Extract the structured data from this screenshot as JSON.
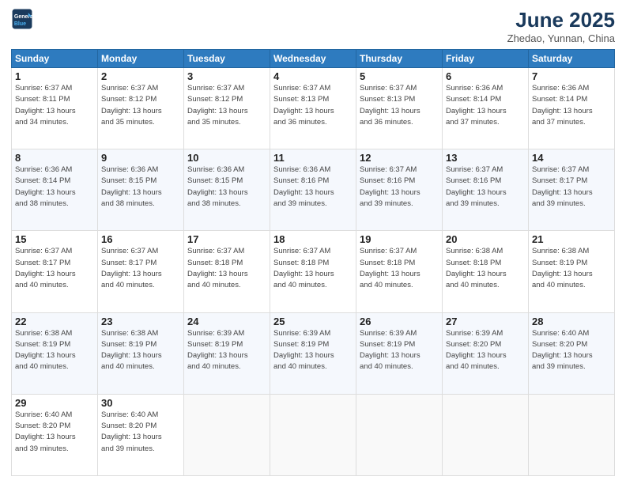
{
  "header": {
    "logo_line1": "General",
    "logo_line2": "Blue",
    "month_year": "June 2025",
    "location": "Zhedao, Yunnan, China"
  },
  "days_of_week": [
    "Sunday",
    "Monday",
    "Tuesday",
    "Wednesday",
    "Thursday",
    "Friday",
    "Saturday"
  ],
  "weeks": [
    [
      {
        "day": "1",
        "info": "Sunrise: 6:37 AM\nSunset: 8:11 PM\nDaylight: 13 hours\nand 34 minutes."
      },
      {
        "day": "2",
        "info": "Sunrise: 6:37 AM\nSunset: 8:12 PM\nDaylight: 13 hours\nand 35 minutes."
      },
      {
        "day": "3",
        "info": "Sunrise: 6:37 AM\nSunset: 8:12 PM\nDaylight: 13 hours\nand 35 minutes."
      },
      {
        "day": "4",
        "info": "Sunrise: 6:37 AM\nSunset: 8:13 PM\nDaylight: 13 hours\nand 36 minutes."
      },
      {
        "day": "5",
        "info": "Sunrise: 6:37 AM\nSunset: 8:13 PM\nDaylight: 13 hours\nand 36 minutes."
      },
      {
        "day": "6",
        "info": "Sunrise: 6:36 AM\nSunset: 8:14 PM\nDaylight: 13 hours\nand 37 minutes."
      },
      {
        "day": "7",
        "info": "Sunrise: 6:36 AM\nSunset: 8:14 PM\nDaylight: 13 hours\nand 37 minutes."
      }
    ],
    [
      {
        "day": "8",
        "info": "Sunrise: 6:36 AM\nSunset: 8:14 PM\nDaylight: 13 hours\nand 38 minutes."
      },
      {
        "day": "9",
        "info": "Sunrise: 6:36 AM\nSunset: 8:15 PM\nDaylight: 13 hours\nand 38 minutes."
      },
      {
        "day": "10",
        "info": "Sunrise: 6:36 AM\nSunset: 8:15 PM\nDaylight: 13 hours\nand 38 minutes."
      },
      {
        "day": "11",
        "info": "Sunrise: 6:36 AM\nSunset: 8:16 PM\nDaylight: 13 hours\nand 39 minutes."
      },
      {
        "day": "12",
        "info": "Sunrise: 6:37 AM\nSunset: 8:16 PM\nDaylight: 13 hours\nand 39 minutes."
      },
      {
        "day": "13",
        "info": "Sunrise: 6:37 AM\nSunset: 8:16 PM\nDaylight: 13 hours\nand 39 minutes."
      },
      {
        "day": "14",
        "info": "Sunrise: 6:37 AM\nSunset: 8:17 PM\nDaylight: 13 hours\nand 39 minutes."
      }
    ],
    [
      {
        "day": "15",
        "info": "Sunrise: 6:37 AM\nSunset: 8:17 PM\nDaylight: 13 hours\nand 40 minutes."
      },
      {
        "day": "16",
        "info": "Sunrise: 6:37 AM\nSunset: 8:17 PM\nDaylight: 13 hours\nand 40 minutes."
      },
      {
        "day": "17",
        "info": "Sunrise: 6:37 AM\nSunset: 8:18 PM\nDaylight: 13 hours\nand 40 minutes."
      },
      {
        "day": "18",
        "info": "Sunrise: 6:37 AM\nSunset: 8:18 PM\nDaylight: 13 hours\nand 40 minutes."
      },
      {
        "day": "19",
        "info": "Sunrise: 6:37 AM\nSunset: 8:18 PM\nDaylight: 13 hours\nand 40 minutes."
      },
      {
        "day": "20",
        "info": "Sunrise: 6:38 AM\nSunset: 8:18 PM\nDaylight: 13 hours\nand 40 minutes."
      },
      {
        "day": "21",
        "info": "Sunrise: 6:38 AM\nSunset: 8:19 PM\nDaylight: 13 hours\nand 40 minutes."
      }
    ],
    [
      {
        "day": "22",
        "info": "Sunrise: 6:38 AM\nSunset: 8:19 PM\nDaylight: 13 hours\nand 40 minutes."
      },
      {
        "day": "23",
        "info": "Sunrise: 6:38 AM\nSunset: 8:19 PM\nDaylight: 13 hours\nand 40 minutes."
      },
      {
        "day": "24",
        "info": "Sunrise: 6:39 AM\nSunset: 8:19 PM\nDaylight: 13 hours\nand 40 minutes."
      },
      {
        "day": "25",
        "info": "Sunrise: 6:39 AM\nSunset: 8:19 PM\nDaylight: 13 hours\nand 40 minutes."
      },
      {
        "day": "26",
        "info": "Sunrise: 6:39 AM\nSunset: 8:19 PM\nDaylight: 13 hours\nand 40 minutes."
      },
      {
        "day": "27",
        "info": "Sunrise: 6:39 AM\nSunset: 8:20 PM\nDaylight: 13 hours\nand 40 minutes."
      },
      {
        "day": "28",
        "info": "Sunrise: 6:40 AM\nSunset: 8:20 PM\nDaylight: 13 hours\nand 39 minutes."
      }
    ],
    [
      {
        "day": "29",
        "info": "Sunrise: 6:40 AM\nSunset: 8:20 PM\nDaylight: 13 hours\nand 39 minutes."
      },
      {
        "day": "30",
        "info": "Sunrise: 6:40 AM\nSunset: 8:20 PM\nDaylight: 13 hours\nand 39 minutes."
      },
      {
        "day": "",
        "info": ""
      },
      {
        "day": "",
        "info": ""
      },
      {
        "day": "",
        "info": ""
      },
      {
        "day": "",
        "info": ""
      },
      {
        "day": "",
        "info": ""
      }
    ]
  ]
}
